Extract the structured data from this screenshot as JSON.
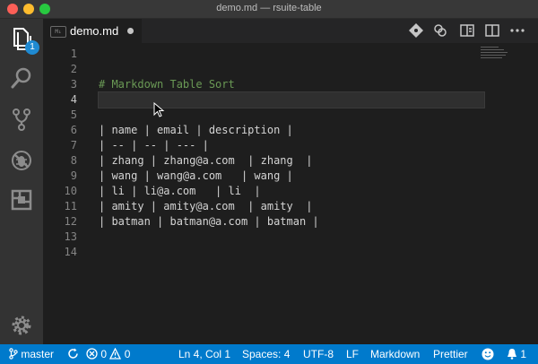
{
  "window": {
    "title": "demo.md — rsuite-table"
  },
  "activity_bar": {
    "explorer_badge": "1"
  },
  "tab": {
    "icon_text": "M↓",
    "label": "demo.md"
  },
  "editor": {
    "active_line": 4,
    "lines": [
      {
        "num": "1",
        "text": ""
      },
      {
        "num": "2",
        "text": ""
      },
      {
        "num": "3",
        "text": "# Markdown Table Sort"
      },
      {
        "num": "4",
        "text": ""
      },
      {
        "num": "5",
        "text": ""
      },
      {
        "num": "6",
        "text": "| name | email | description |"
      },
      {
        "num": "7",
        "text": "| -- | -- | --- |"
      },
      {
        "num": "8",
        "text": "| zhang | zhang@a.com  | zhang  |"
      },
      {
        "num": "9",
        "text": "| wang | wang@a.com   | wang |"
      },
      {
        "num": "10",
        "text": "| li | li@a.com   | li  |"
      },
      {
        "num": "11",
        "text": "| amity | amity@a.com  | amity  |"
      },
      {
        "num": "12",
        "text": "| batman | batman@a.com | batman |"
      },
      {
        "num": "13",
        "text": ""
      },
      {
        "num": "14",
        "text": ""
      }
    ]
  },
  "status_bar": {
    "branch": "master",
    "errors": "0",
    "warnings": "0",
    "position": "Ln 4, Col 1",
    "spaces": "Spaces: 4",
    "encoding": "UTF-8",
    "eol": "LF",
    "language": "Markdown",
    "formatter": "Prettier",
    "notifications": "1"
  },
  "colors": {
    "status_bar": "#007acc",
    "editor_bg": "#1e1e1e",
    "activity_bar": "#333333",
    "heading": "#6a9955"
  }
}
